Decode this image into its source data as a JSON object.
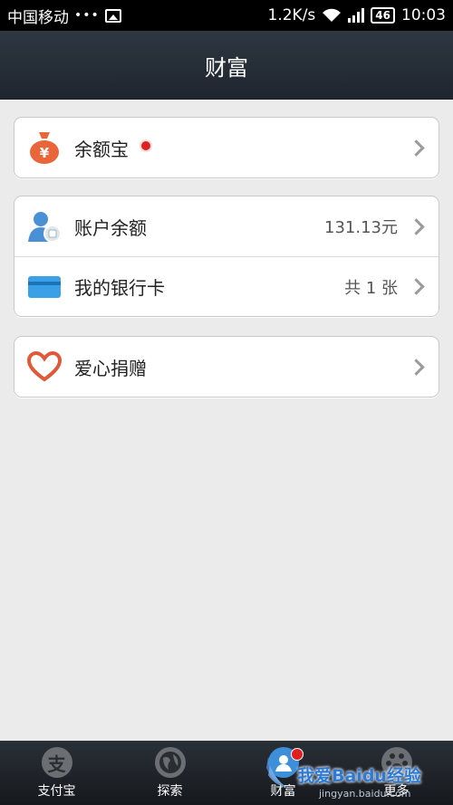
{
  "status_bar": {
    "carrier": "中国移动",
    "dots": "•••",
    "speed": "1.2K/s",
    "battery": "46",
    "time": "10:03"
  },
  "header": {
    "title": "财富"
  },
  "cards": [
    {
      "items": [
        {
          "label": "余额宝",
          "icon": "money-bag-icon",
          "has_dot": true
        }
      ]
    },
    {
      "items": [
        {
          "label": "账户余额",
          "icon": "account-user-icon",
          "value": "131.13元"
        },
        {
          "label": "我的银行卡",
          "icon": "bank-card-icon",
          "value": "共 1 张"
        }
      ]
    },
    {
      "items": [
        {
          "label": "爱心捐赠",
          "icon": "heart-icon"
        }
      ]
    }
  ],
  "tabs": [
    {
      "label": "支付宝",
      "glyph": "支",
      "icon": "alipay-icon"
    },
    {
      "label": "探索",
      "glyph": "",
      "icon": "globe-icon"
    },
    {
      "label": "财富",
      "glyph": "",
      "icon": "wealth-icon",
      "active": true,
      "badge": true
    },
    {
      "label": "更多",
      "glyph": "",
      "icon": "more-icon"
    }
  ],
  "watermark": {
    "main": "我爱Baidu经验",
    "sub": "jingyan.baidu.com"
  },
  "colors": {
    "accent": "#3c8fd8",
    "alert": "#e02020",
    "orange_icon": "#e8663a",
    "header_bg": "#232a33"
  }
}
